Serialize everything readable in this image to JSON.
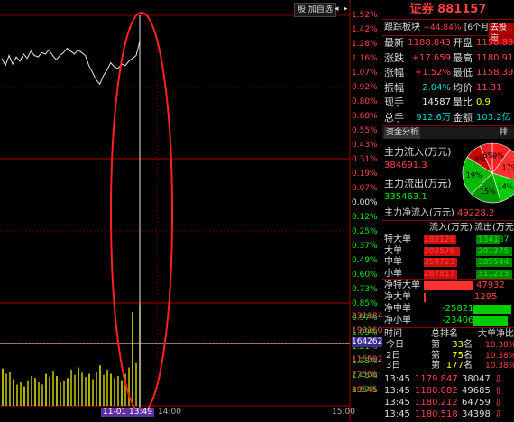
{
  "toolbar": {
    "stock_label": "股",
    "watch_label": "加自选",
    "prev_icon": "triangle-left",
    "next_icon": "triangle-right"
  },
  "y_axis_labels": [
    "1.52%",
    "1.42%",
    "1.28%",
    "1.16%",
    "1.07%",
    "0.92%",
    "0.80%",
    "0.68%",
    "0.55%",
    "0.43%",
    "0.31%",
    "0.19%",
    "0.07%",
    "0.00%",
    "0.12%",
    "0.25%",
    "0.37%",
    "0.49%",
    "0.60%",
    "0.73%",
    "0.85%",
    "0.97%",
    "1.09%",
    "1.21%",
    "1.33%",
    "1.45%",
    "1.57%"
  ],
  "volume_axis_labels": [
    "231184",
    "193160",
    "164262",
    "115592",
    "77558",
    "39545"
  ],
  "time_axis": {
    "mid": "14:00",
    "end": "15:00",
    "cursor": "11-01 13:49"
  },
  "line_data": [
    0.99,
    0.985,
    0.992,
    0.986,
    0.991,
    0.988,
    0.993,
    0.99,
    0.995,
    0.992,
    0.991,
    0.994,
    0.993,
    0.996,
    0.992,
    0.989,
    0.992,
    0.994,
    0.997,
    0.995,
    0.993,
    0.996,
    0.994,
    0.992,
    0.985,
    0.98,
    0.975,
    0.972,
    0.978,
    0.982,
    0.987,
    0.984,
    0.983,
    0.986,
    0.985,
    0.988,
    0.99,
    0.992,
    1.002
  ],
  "volume_data": [
    0.35,
    0.3,
    0.32,
    0.25,
    0.2,
    0.22,
    0.18,
    0.24,
    0.28,
    0.26,
    0.22,
    0.2,
    0.3,
    0.27,
    0.33,
    0.28,
    0.22,
    0.24,
    0.26,
    0.34,
    0.29,
    0.36,
    0.31,
    0.27,
    0.3,
    0.25,
    0.32,
    0.38,
    0.29,
    0.34,
    0.3,
    0.26,
    0.28,
    0.24,
    0.3,
    0.36,
    0.88,
    0.4,
    0.95
  ],
  "header": {
    "title": "证券 881157"
  },
  "sector_row": {
    "label": "跟踪板块",
    "value": "+44.84%",
    "period": "[6个月]",
    "action": "去投资"
  },
  "quote_rows": [
    {
      "l1": "最新",
      "v1": "1188.843",
      "l2": "开盘",
      "v2": "1158.83",
      "c1": "red",
      "c2": "red"
    },
    {
      "l1": "涨跌",
      "v1": "+17.659",
      "l2": "最高",
      "v2": "1180.91",
      "c1": "red",
      "c2": "red"
    },
    {
      "l1": "涨幅",
      "v1": "+1.52%",
      "l2": "最低",
      "v2": "1158.39",
      "c1": "red",
      "c2": "red"
    },
    {
      "l1": "振幅",
      "v1": "2.04%",
      "l2": "均价",
      "v2": "11.31",
      "c1": "cyan",
      "c2": "red"
    },
    {
      "l1": "现手",
      "v1": "14587",
      "l2": "量比",
      "v2": "0.9",
      "c1": "white",
      "c2": "yellow"
    },
    {
      "l1": "总手",
      "v1": "912.6万",
      "l2": "金额",
      "v2": "103.2亿",
      "c1": "cyan",
      "c2": "cyan"
    }
  ],
  "fund_tab": {
    "title": "资金分析",
    "side": "排"
  },
  "fund_flow": {
    "in_label": "主力流入(万元)",
    "in_value": "384691.3",
    "out_label": "主力流出(万元)",
    "out_value": "335463.1",
    "net_label": "主力净流入(万元)",
    "net_value": "49228.2"
  },
  "pie": {
    "slices": [
      {
        "label": "9%",
        "value": 9,
        "color": "#ff2020"
      },
      {
        "label": "17%",
        "value": 17,
        "color": "#ff3030"
      },
      {
        "label": "14%",
        "value": 14,
        "color": "#00cc00"
      },
      {
        "label": "15%",
        "value": 15,
        "color": "#009900"
      },
      {
        "label": "19%",
        "value": 19,
        "color": "#00bb00"
      },
      {
        "label": "8%",
        "value": 8,
        "color": "#cc0000"
      },
      {
        "label": "6%",
        "value": 6,
        "color": "#ee2222"
      }
    ]
  },
  "flow_table": {
    "head_in": "流入(万元)",
    "head_out": "流出(万元)",
    "rows": [
      {
        "label": "特大单",
        "in": "182128",
        "out": "134187",
        "in_frac": 0.9,
        "out_frac": 0.66
      },
      {
        "label": "大单",
        "in": "202578",
        "out": "201275",
        "in_frac": 1.0,
        "out_frac": 0.99
      },
      {
        "label": "中单",
        "in": "359723",
        "out": "385544",
        "in_frac": 0.93,
        "out_frac": 1.0
      },
      {
        "label": "小单",
        "in": "287817",
        "out": "311223",
        "in_frac": 0.92,
        "out_frac": 1.0
      }
    ]
  },
  "net_rows": [
    {
      "label": "净特大单",
      "value": "47932",
      "color": "#ff3030",
      "frac": 1.0,
      "neg": false
    },
    {
      "label": "净大单",
      "value": "1295",
      "color": "#ff3030",
      "frac": 0.03,
      "neg": false
    },
    {
      "label": "净中单",
      "value": "-25821",
      "color": "#00cc00",
      "frac": 0.54,
      "neg": true
    },
    {
      "label": "净小单",
      "value": "-23406",
      "color": "#00cc00",
      "frac": 0.49,
      "neg": true
    }
  ],
  "rank_table": {
    "head_time": "时间",
    "head_rank": "总排名",
    "head_big": "大单净比",
    "rows": [
      {
        "day": "今日",
        "pre": "第",
        "rank": "33",
        "suf": "名",
        "pct": "10.38%"
      },
      {
        "day": "2日",
        "pre": "第",
        "rank": "75",
        "suf": "名",
        "pct": "10.38%"
      },
      {
        "day": "3日",
        "pre": "第",
        "rank": "177",
        "suf": "名",
        "pct": "10.38%"
      }
    ]
  },
  "ticks": [
    {
      "time": "13:45",
      "price": "1179.847",
      "vol": "38047",
      "arrow": "⇩"
    },
    {
      "time": "13:45",
      "price": "1180.082",
      "vol": "49685",
      "arrow": "⇧"
    },
    {
      "time": "13:45",
      "price": "1180.212",
      "vol": "64759",
      "arrow": "⇩"
    },
    {
      "time": "13:45",
      "price": "1180.518",
      "vol": "34398",
      "arrow": "⇩"
    }
  ]
}
